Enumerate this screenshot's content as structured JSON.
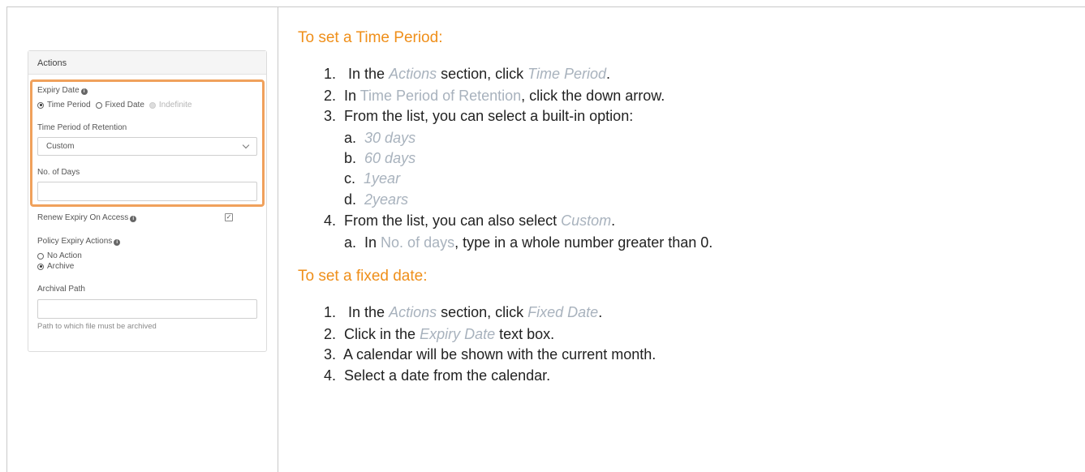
{
  "left_panel": {
    "header": "Actions",
    "expiry_date_label": "Expiry Date",
    "expiry_options": [
      "Time Period",
      "Fixed Date",
      "Indefinite"
    ],
    "expiry_selected": "Time Period",
    "time_period_label": "Time Period of Retention",
    "time_period_value": "Custom",
    "days_label": "No. of Days",
    "days_value": "",
    "renew_label": "Renew Expiry On Access",
    "renew_checked": true,
    "policy_label": "Policy Expiry Actions",
    "policy_options": [
      "No Action",
      "Archive"
    ],
    "policy_selected": "Archive",
    "archival_label": "Archival Path",
    "archival_value": "",
    "archival_help": "Path to which file must be archived",
    "highlight_color": "#f0a15c"
  },
  "right_panel": {
    "section1_title": "To set a Time Period:",
    "s1": {
      "step1": {
        "num": "1.",
        "pre": "In the ",
        "ref1": "Actions",
        "mid": " section, click ",
        "ref2": "Time Period",
        "post": "."
      },
      "step2": {
        "num": "2.",
        "pre": "In ",
        "ref1": "Time Period of Retention",
        "post": ", click the down arrow."
      },
      "step3": {
        "num": "3.",
        "text": "From the list, you can select a built-in option:"
      },
      "options": [
        {
          "letter": "a.",
          "value": "30 days"
        },
        {
          "letter": "b.",
          "value": "60 days"
        },
        {
          "letter": "c.",
          "value": "1year"
        },
        {
          "letter": "d.",
          "value": "2years"
        }
      ],
      "step4": {
        "num": "4.",
        "pre": "From the list, you can also select ",
        "ref1": "Custom",
        "post": "."
      },
      "step4a": {
        "letter": "a.",
        "pre": "In ",
        "ref1": "No. of days",
        "post": ", type in a whole number greater than 0."
      }
    },
    "section2_title": "To set a fixed date:",
    "s2": {
      "step1": {
        "num": "1.",
        "pre": "In the ",
        "ref1": "Actions",
        "mid": " section, click ",
        "ref2": "Fixed Date",
        "post": "."
      },
      "step2": {
        "num": "2.",
        "pre": "Click in the ",
        "ref1": "Expiry Date",
        "post": " text box."
      },
      "step3": {
        "num": "3.",
        "text": "A calendar will be shown with the current month."
      },
      "step4": {
        "num": "4.",
        "text": "Select a date from the calendar."
      }
    },
    "heading_color": "#ef8f1a",
    "reference_color": "#a8b2bd"
  }
}
